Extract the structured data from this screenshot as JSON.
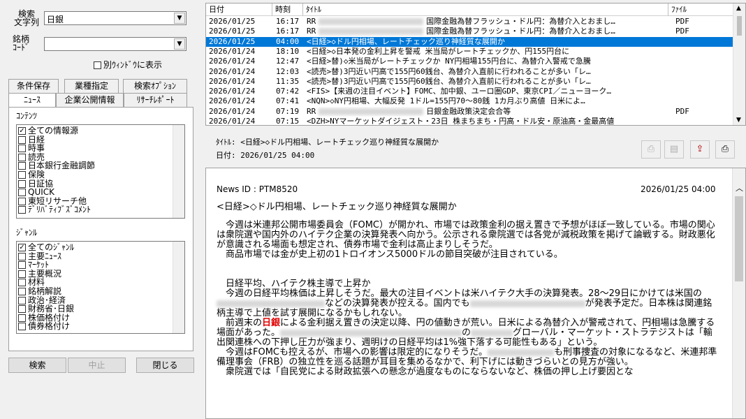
{
  "search": {
    "text_label": "検索\n文字列",
    "text_value": "日銀",
    "code_label": "銘柄\nｺｰﾄﾞ",
    "code_value": "",
    "separate_window_label": "別ｳｨﾝﾄﾞｳに表示"
  },
  "tabs_row1": [
    "条件保存",
    "業種指定",
    "検索ｵﾌﾟｼｮﾝ"
  ],
  "tabs_row2": [
    "ﾆｭｰｽ",
    "企業公開情報",
    "ﾘｻｰﾁﾚﾎﾟｰﾄ"
  ],
  "contents": {
    "label": "ｺﾝﾃﾝﾂ",
    "items": [
      {
        "label": "全ての情報源",
        "checked": true
      },
      {
        "label": "日経",
        "checked": false
      },
      {
        "label": "時事",
        "checked": false
      },
      {
        "label": "読売",
        "checked": false
      },
      {
        "label": "日本銀行金融調節",
        "checked": false
      },
      {
        "label": "保険",
        "checked": false
      },
      {
        "label": "日証協",
        "checked": false
      },
      {
        "label": "QUICK",
        "checked": false
      },
      {
        "label": "東短リサーチ他",
        "checked": false
      },
      {
        "label": "ﾃﾞﾘﾊﾞﾃｨﾌﾞｽﾞｺﾒﾝﾄ",
        "checked": false
      }
    ]
  },
  "genre": {
    "label": "ｼﾞｬﾝﾙ",
    "items": [
      {
        "label": "全てのｼﾞｬﾝﾙ",
        "checked": true
      },
      {
        "label": "主要ﾆｭｰｽ",
        "checked": false
      },
      {
        "label": "ﾏｰｹｯﾄ",
        "checked": false
      },
      {
        "label": "主要概況",
        "checked": false
      },
      {
        "label": "材料",
        "checked": false
      },
      {
        "label": "銘柄解説",
        "checked": false
      },
      {
        "label": "政治･経済",
        "checked": false
      },
      {
        "label": "財務省･日銀",
        "checked": false
      },
      {
        "label": "株価格付け",
        "checked": false
      },
      {
        "label": "債券格付け",
        "checked": false
      }
    ]
  },
  "buttons": {
    "search": "検索",
    "stop": "中止",
    "close": "閉じる"
  },
  "news_list": {
    "headers": {
      "date": "日付",
      "time": "時刻",
      "title": "ﾀｲﾄﾙ",
      "file": "ﾌｧｲﾙ"
    },
    "rows": [
      {
        "date": "2026/01/25",
        "time": "16:17",
        "title": "RR",
        "title2": "国際金融為替フラッシュ・ドル円：為替介入とおまし…",
        "file": "PDF",
        "selected": false
      },
      {
        "date": "2026/01/25",
        "time": "16:17",
        "title": "RR",
        "title2": "国際金融為替フラッシュ・ドル円：為替介入とおまし…",
        "file": "PDF",
        "selected": false
      },
      {
        "date": "2026/01/25",
        "time": "04:00",
        "title": "<日経>◇ドル円相場、レートチェック巡り神経質な展開か",
        "title2": "",
        "file": "",
        "selected": true
      },
      {
        "date": "2026/01/24",
        "time": "18:10",
        "title": "<日経>◇日本発の金利上昇を警戒 米当局がレートチェックか、円155円台に",
        "title2": "",
        "file": "",
        "selected": false
      },
      {
        "date": "2026/01/24",
        "time": "12:47",
        "title": "<日経>替)◇米当局がレートチェックか NY円相場155円台に、為替介入警戒で急騰",
        "title2": "",
        "file": "",
        "selected": false
      },
      {
        "date": "2026/01/24",
        "time": "12:03",
        "title": "<読売>替)3円近い円高で155円60銭台、為替介入直前に行われることが多い「レ…",
        "title2": "",
        "file": "",
        "selected": false
      },
      {
        "date": "2026/01/24",
        "time": "11:35",
        "title": "<読売>替)3円近い円高で155円60銭台、為替介入直前に行われることが多い「レ…",
        "title2": "",
        "file": "",
        "selected": false
      },
      {
        "date": "2026/01/24",
        "time": "07:42",
        "title": "<FIS>【来週の注目イベント】FOMC、加中銀、ユーロ圏GDP、東京CPI／ニューヨーク…",
        "title2": "",
        "file": "",
        "selected": false
      },
      {
        "date": "2026/01/24",
        "time": "07:41",
        "title": "<NQN>◇NY円相場、大幅反発 1ドル=155円70～80銭 1カ月ぶり高値 日米によ…",
        "title2": "",
        "file": "",
        "selected": false
      },
      {
        "date": "2026/01/24",
        "time": "07:19",
        "title": "RR",
        "title2": "日銀金融政策決定会合等",
        "file": "PDF",
        "selected": false
      },
      {
        "date": "2026/01/24",
        "time": "07:15",
        "title": "<DZH>NYマーケットダイジェスト・23日 株まちまち・円高・ドル安・原油高・金最高値",
        "title2": "",
        "file": "",
        "selected": false
      }
    ]
  },
  "detail": {
    "title_line": "ﾀｲﾄﾙ: <日経>◇ドル円相場、レートチェック巡り神経質な展開か",
    "date_line": "日付: 2026/01/25 04:00"
  },
  "toolbar_icons": [
    "pdf-icon",
    "document-icon",
    "export-icon",
    "print-icon"
  ],
  "article": {
    "news_id": "News ID : PTM8520",
    "datetime": "2026/01/25 04:00",
    "headline": "<日経>◇ドル円相場、レートチェック巡り神経質な展開か",
    "p1": "　今週は米連邦公開市場委員会（FOMC）が開かれ、市場では政策金利の据え置きで予想がほぼ一致している。市場の関心は衆院選や国内外のハイテク企業の決算発表へ向かう。公示される衆院選では各党が減税政策を掲げて論戦する。財政悪化が意識される場面も想定され、債券市場で金利は高止まりしそうだ。",
    "p2": "　商品市場では金が史上初の1トロイオンス5000ドルの節目突破が注目されている。",
    "h2": "　日経平均、ハイテク株主導で上昇か",
    "p3a": "　今週の日経平均株価は上昇しそうだ。最大の注目イベントは米ハイテク大手の決算発表。28～29日にかけては米国の",
    "p3b": "などの決算発表が控える。国内でも",
    "p3c": "が発表予定だ。日本株は関連銘柄主導で上値を試す展開になるかもしれない。",
    "p4a": "　前週末の",
    "p4hl": "日銀",
    "p4b": "による金利据え置きの決定以降、円の値動きが荒い。日米による為替介入が警戒されて、円相場は急騰する場面があった。",
    "p4c": "の",
    "p4d": "グローバル・マーケット・ストラテジストは「輸出関連株への下押し圧力が強まり、週明けの日経平均は1%強下落する可能性もある」という。",
    "p5a": "　今週はFOMCも控えるが、市場への影響は限定的になりそうだ。",
    "p5b": "も刑事捜査の対象になるなど、米連邦準備理事会（FRB）の独立性を巡る話題が耳目を集めるなかで、利下げには動きづらいとの見方が強い。",
    "p6": "　衆院選では「自民党による財政拡張への懸念が過度なものにならないなど、株価の押し上げ要因とな"
  }
}
